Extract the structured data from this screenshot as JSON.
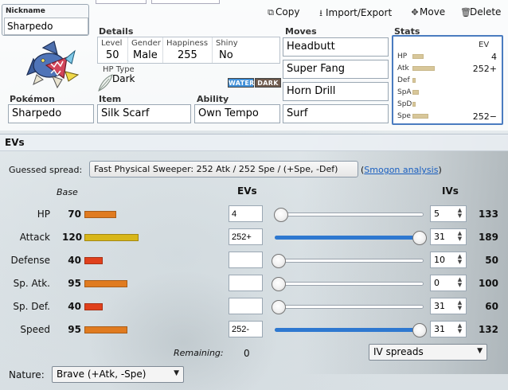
{
  "toolbar": {
    "copy_label": "Copy",
    "import_export_label": "Import/Export",
    "move_label": "Move",
    "delete_label": "Delete"
  },
  "nickname": {
    "label": "Nickname",
    "value": "Sharpedo"
  },
  "details": {
    "section_label": "Details",
    "level_label": "Level",
    "level_value": "50",
    "gender_label": "Gender",
    "gender_value": "Male",
    "happiness_label": "Happiness",
    "happiness_value": "255",
    "shiny_label": "Shiny",
    "shiny_value": "No",
    "hp_type_label": "HP Type",
    "hp_type_value": "Dark"
  },
  "types": [
    {
      "name": "WATER",
      "color": "#3f8fd8"
    },
    {
      "name": "DARK",
      "color": "#6e5a4d"
    }
  ],
  "fields": {
    "pokemon_label": "Pokémon",
    "pokemon_value": "Sharpedo",
    "item_label": "Item",
    "item_value": "Silk Scarf",
    "ability_label": "Ability",
    "ability_value": "Own Tempo"
  },
  "moves": {
    "label": "Moves",
    "list": [
      "Headbutt",
      "Super Fang",
      "Horn Drill",
      "Surf"
    ]
  },
  "stats_panel": {
    "label": "Stats",
    "ev_header": "EV",
    "rows": [
      {
        "name": "HP",
        "ev": "4"
      },
      {
        "name": "Atk",
        "ev": "252+"
      },
      {
        "name": "Def",
        "ev": ""
      },
      {
        "name": "SpA",
        "ev": ""
      },
      {
        "name": "SpD",
        "ev": ""
      },
      {
        "name": "Spe",
        "ev": "252−"
      }
    ]
  },
  "ev_section": {
    "title": "EVs",
    "guessed_label": "Guessed spread:",
    "guessed_value": "Fast Physical Sweeper: 252 Atk / 252 Spe / (+Spe, -Def)",
    "smogon_open": "(",
    "smogon_link": "Smogon analysis",
    "smogon_close": ")",
    "base_header": "Base",
    "evs_header": "EVs",
    "ivs_header": "IVs",
    "remaining_label": "Remaining:",
    "remaining_value": "0",
    "iv_spreads_label": "IV spreads",
    "nature_label": "Nature:",
    "nature_value": "Brave (+Atk, -Spe)",
    "bar_colors": {
      "low": "#e0401c",
      "mid": "#e07b20",
      "high": "#d8b619"
    },
    "slider_color": "#2e78d0",
    "stats": [
      {
        "name": "HP",
        "base": "70",
        "ev": "4",
        "ev_fraction": 0.016,
        "iv": "5",
        "total": "133",
        "bar": "mid"
      },
      {
        "name": "Attack",
        "base": "120",
        "ev": "252+",
        "ev_fraction": 1.0,
        "iv": "31",
        "total": "189",
        "bar": "high"
      },
      {
        "name": "Defense",
        "base": "40",
        "ev": "",
        "ev_fraction": 0,
        "iv": "10",
        "total": "50",
        "bar": "low"
      },
      {
        "name": "Sp. Atk.",
        "base": "95",
        "ev": "",
        "ev_fraction": 0,
        "iv": "0",
        "total": "100",
        "bar": "mid"
      },
      {
        "name": "Sp. Def.",
        "base": "40",
        "ev": "",
        "ev_fraction": 0,
        "iv": "31",
        "total": "60",
        "bar": "low"
      },
      {
        "name": "Speed",
        "base": "95",
        "ev": "252-",
        "ev_fraction": 1.0,
        "iv": "31",
        "total": "132",
        "bar": "mid"
      }
    ]
  },
  "icons": {
    "copy": "copy-icon",
    "import_export": "download-icon",
    "move": "move-arrows-icon",
    "delete": "trash-icon"
  }
}
